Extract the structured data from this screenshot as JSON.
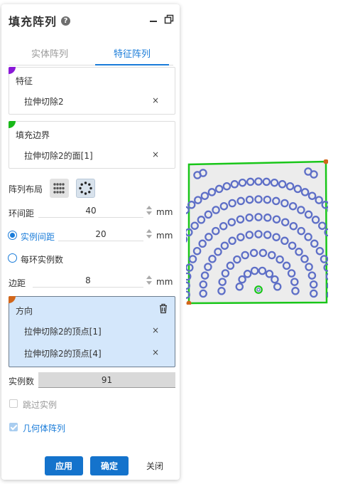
{
  "header": {
    "title": "填充阵列",
    "help_glyph": "?"
  },
  "tabs": [
    {
      "label": "实体阵列",
      "active": false
    },
    {
      "label": "特征阵列",
      "active": true
    }
  ],
  "features_box": {
    "label": "特征",
    "item": "拉伸切除2",
    "remove": "×",
    "corner_color": "#8a18d8"
  },
  "boundary_box": {
    "label": "填充边界",
    "item": "拉伸切除2的面[1]",
    "remove": "×",
    "corner_color": "#19b919"
  },
  "layout": {
    "label": "阵列布局",
    "options": [
      "grid-layout-icon",
      "circular-layout-icon"
    ],
    "selected": 1
  },
  "ring_spacing": {
    "label": "环间距",
    "value": "40",
    "unit": "mm"
  },
  "instance_spacing": {
    "label": "实例间距",
    "value": "20",
    "unit": "mm",
    "selected": true
  },
  "per_ring_count": {
    "label": "每环实例数",
    "selected": false
  },
  "margin": {
    "label": "边距",
    "value": "8",
    "unit": "mm"
  },
  "direction": {
    "label": "方向",
    "items": [
      {
        "text": "拉伸切除2的顶点[1]",
        "remove": "×"
      },
      {
        "text": "拉伸切除2的顶点[4]",
        "remove": "×"
      }
    ],
    "corner_color": "#d2661a"
  },
  "instance_count": {
    "label": "实例数",
    "value": "91"
  },
  "skip_instances": {
    "label": "跳过实例",
    "checked": false
  },
  "geometry_pattern": {
    "label": "几何体阵列",
    "checked": true
  },
  "buttons": {
    "apply": "应用",
    "ok": "确定",
    "close": "关闭"
  },
  "colors": {
    "accent": "#1473cc",
    "preview_ring": "#5e6fc7",
    "preview_border": "#19c619",
    "preview_vertex": "#d2661a",
    "preview_fill": "#ececec"
  }
}
